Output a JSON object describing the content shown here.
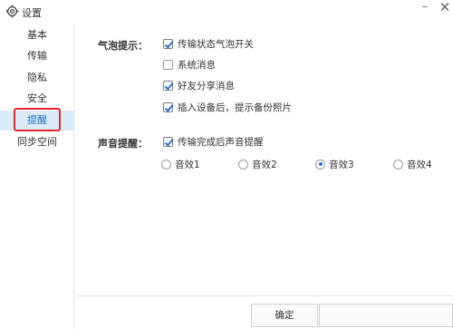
{
  "window": {
    "title": "设置",
    "min_glyph": "–",
    "close_glyph": "✕"
  },
  "sidebar": {
    "items": [
      {
        "label": "基本"
      },
      {
        "label": "传输"
      },
      {
        "label": "隐私"
      },
      {
        "label": "安全"
      },
      {
        "label": "提醒",
        "active": true
      },
      {
        "label": "同步空间"
      }
    ]
  },
  "bubble": {
    "label": "气泡提示：",
    "options": [
      {
        "label": "传输状态气泡开关",
        "checked": true
      },
      {
        "label": "系统消息",
        "checked": false
      },
      {
        "label": "好友分享消息",
        "checked": true
      },
      {
        "label": "插入设备后，提示备份照片",
        "checked": true
      }
    ]
  },
  "sound": {
    "label": "声音提醒：",
    "checkbox": {
      "label": "传输完成后声音提醒",
      "checked": true
    },
    "options": [
      {
        "label": "音效1",
        "selected": false
      },
      {
        "label": "音效2",
        "selected": false
      },
      {
        "label": "音效3",
        "selected": true
      },
      {
        "label": "音效4",
        "selected": false
      }
    ]
  },
  "footer": {
    "ok_label": "确定",
    "cancel_label": ""
  },
  "colors": {
    "accent": "#2f6fd0",
    "active_bg": "#dcebf9",
    "highlight_border": "#e8262b"
  }
}
